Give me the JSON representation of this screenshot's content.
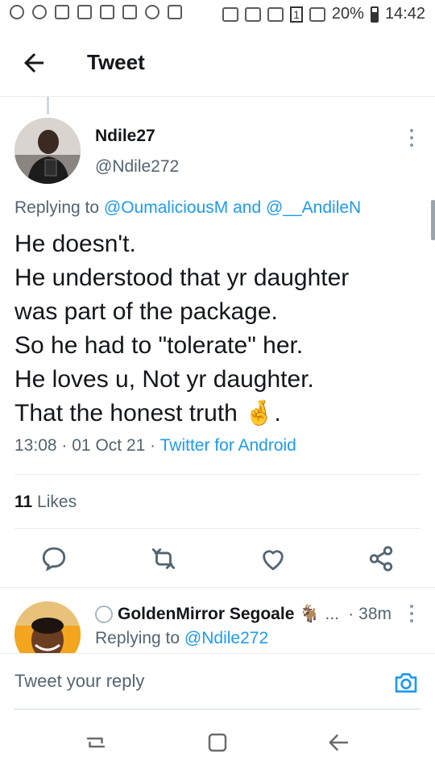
{
  "status_bar": {
    "battery": "20%",
    "time": "14:42",
    "sim_badge": "1"
  },
  "header": {
    "title": "Tweet"
  },
  "tweet": {
    "author_name": "Ndile27",
    "author_handle": "@Ndile272",
    "replying_prefix": "Replying to",
    "replying_mention_1": "@OumaliciousM",
    "replying_and": "and",
    "replying_mention_2": "@__AndileN",
    "lines": [
      "He doesn't.",
      "He understood that yr daughter",
      "was part of the package.",
      "So he had to \"tolerate\" her.",
      "He loves u, Not yr daughter.",
      "That the honest truth 🤞."
    ],
    "time": "13:08",
    "date": "01 Oct 21",
    "source": "Twitter for Android",
    "likes_count": "11",
    "likes_label": "Likes"
  },
  "reply": {
    "name": "GoldenMirror Segoale",
    "name_emoji": "🐐",
    "ellipsis": "...",
    "time": "38m",
    "replying_prefix": "Replying to",
    "replying_mention": "@Ndile272"
  },
  "compose": {
    "placeholder": "Tweet your reply"
  },
  "colors": {
    "accent": "#1d9bf0",
    "text": "#14171a",
    "secondary": "#536471",
    "divider": "#e6ecf0"
  },
  "icons": [
    "back-arrow-icon",
    "more-vertical-icon",
    "reply-icon",
    "retweet-icon",
    "like-icon",
    "share-icon",
    "camera-icon",
    "recents-icon",
    "home-icon",
    "back-nav-icon"
  ]
}
